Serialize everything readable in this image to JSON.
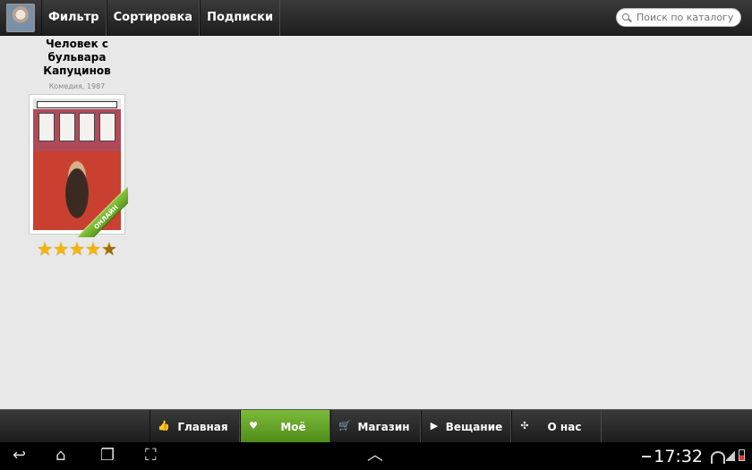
{
  "topbar": {
    "buttons": [
      {
        "label": "Фильтр"
      },
      {
        "label": "Сортировка"
      },
      {
        "label": "Подписки"
      }
    ],
    "search_placeholder": "Поиск по каталогу"
  },
  "catalog": {
    "items": [
      {
        "title": "Человек с бульвара Капуцинов",
        "subtitle": "Комедия, 1987",
        "badge": "ОНЛАЙН",
        "rating": 4.5
      }
    ]
  },
  "bottomnav": {
    "items": [
      {
        "label": "Главная",
        "icon": "thumbs-up-icon"
      },
      {
        "label": "Моё",
        "icon": "heart-icon",
        "active": true
      },
      {
        "label": "Магазин",
        "icon": "cart-icon"
      },
      {
        "label": "Вещание",
        "icon": "play-icon"
      },
      {
        "label": "О нас",
        "icon": "grid-icon"
      }
    ]
  },
  "systembar": {
    "time": "17:32"
  },
  "colors": {
    "accent": "#6aac2c",
    "star": "#f7b500"
  }
}
